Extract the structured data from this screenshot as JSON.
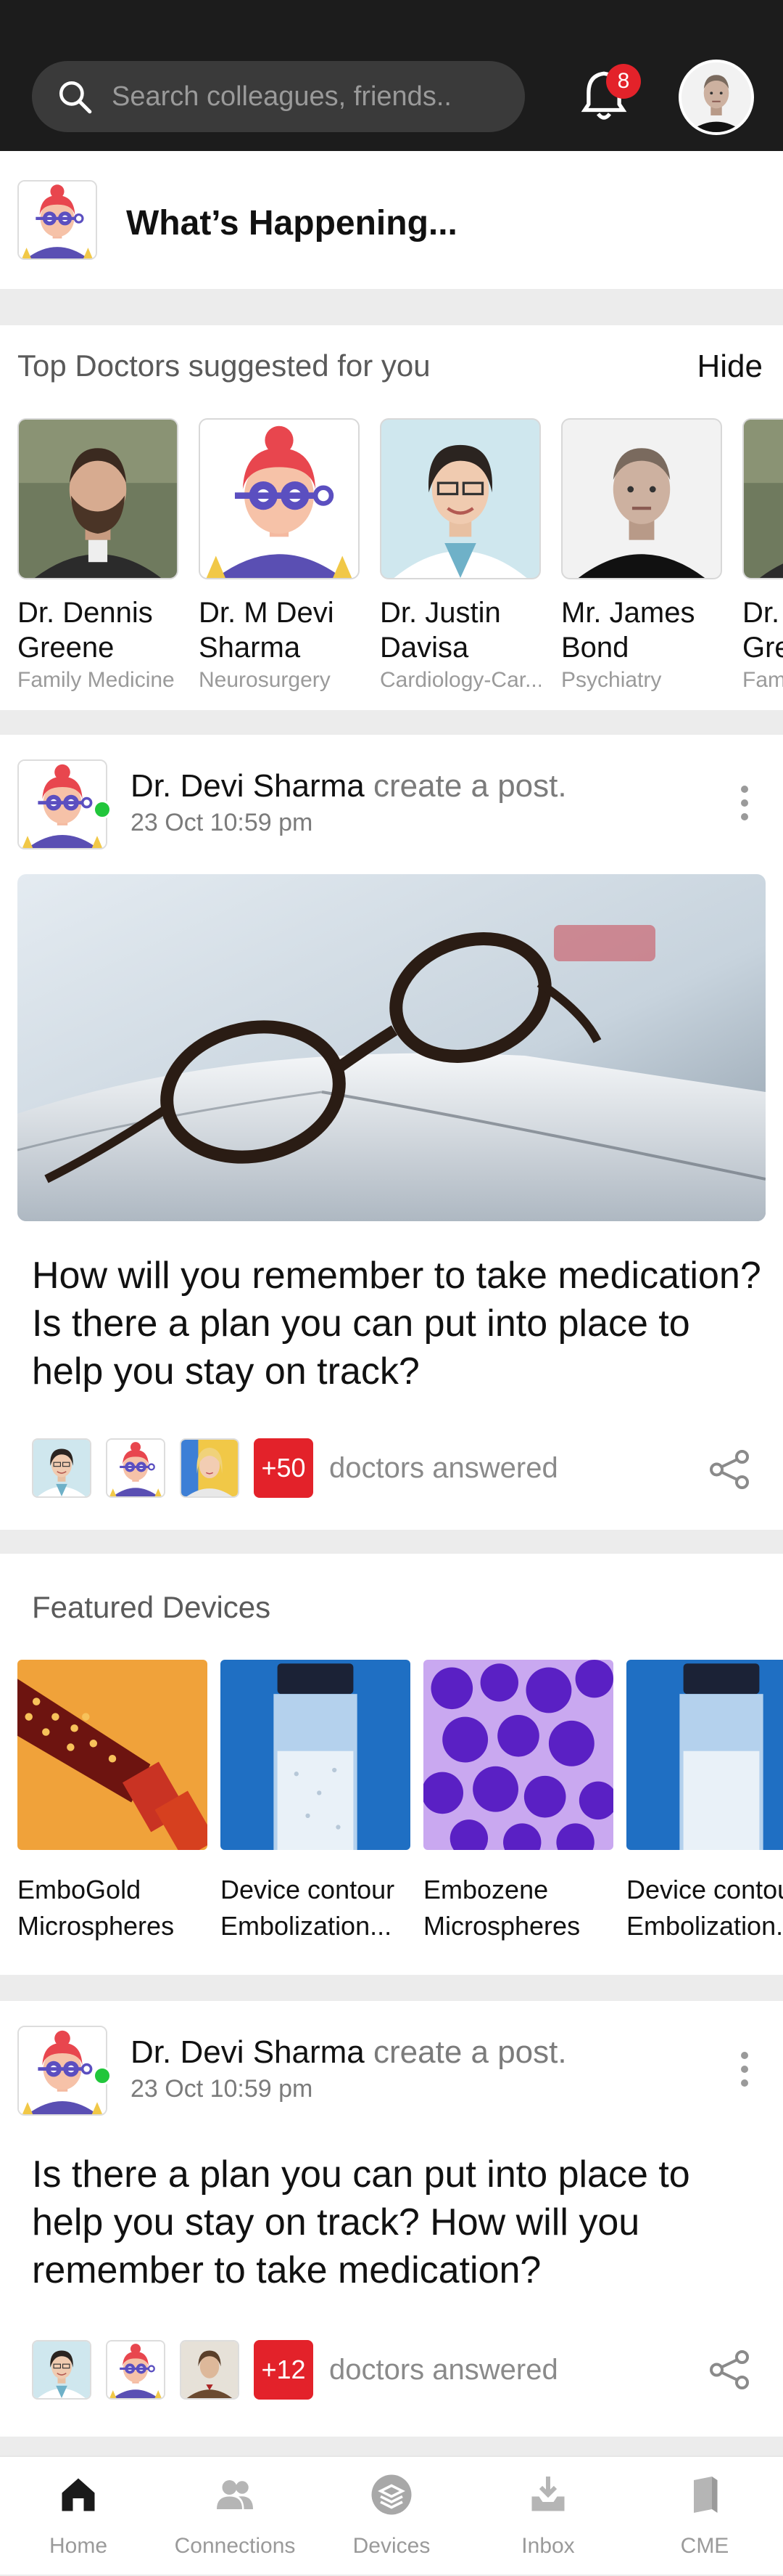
{
  "header": {
    "search_placeholder": "Search colleagues, friends..",
    "notification_count": "8"
  },
  "whats_happening": {
    "label": "What’s Happening..."
  },
  "top_doctors": {
    "title": "Top Doctors suggested for you",
    "hide_label": "Hide",
    "doctors": [
      {
        "name": "Dr. Dennis Greene",
        "specialty": "Family Medicine"
      },
      {
        "name": "Dr. M Devi Sharma",
        "specialty": "Neurosurgery"
      },
      {
        "name": "Dr. Justin Davisa",
        "specialty": "Cardiology-Car..."
      },
      {
        "name": "Mr. James Bond",
        "specialty": "Psychiatry"
      },
      {
        "name": "Dr. Gre",
        "specialty": "Fam"
      }
    ]
  },
  "posts": [
    {
      "author": "Dr. Devi Sharma",
      "action": "create a post.",
      "date": "23 Oct 10:59 pm",
      "text": "How will you remember to take medication? Is there a plan you can put into place to help you stay on track?",
      "answer_count": "+50",
      "answers_label": "doctors answered"
    },
    {
      "author": "Dr. Devi Sharma",
      "action": "create a post.",
      "date": "23 Oct 10:59 pm",
      "text": "Is there a plan you can put into place to help you stay on track? How will you remember to take medication?",
      "answer_count": "+12",
      "answers_label": "doctors answered"
    }
  ],
  "featured_devices": {
    "title": "Featured Devices",
    "devices": [
      {
        "line1": "EmboGold",
        "line2": "Microspheres"
      },
      {
        "line1": "Device contour",
        "line2": "Embolization..."
      },
      {
        "line1": "Embozene",
        "line2": "Microspheres"
      },
      {
        "line1": "Device contour",
        "line2": "Embolization..."
      }
    ]
  },
  "nav": {
    "items": [
      {
        "label": "Home",
        "icon": "home-icon"
      },
      {
        "label": "Connections",
        "icon": "connections-icon"
      },
      {
        "label": "Devices",
        "icon": "devices-icon"
      },
      {
        "label": "Inbox",
        "icon": "inbox-icon"
      },
      {
        "label": "CME",
        "icon": "cme-icon"
      }
    ]
  },
  "colors": {
    "accent": "#e3222a",
    "header_bg": "#1c1c1c",
    "online": "#21c63b"
  }
}
